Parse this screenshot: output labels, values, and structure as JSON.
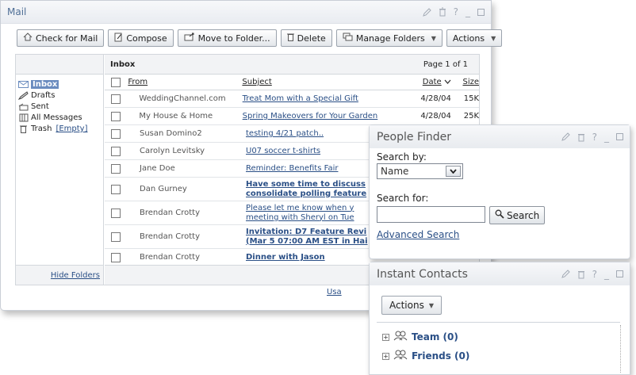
{
  "mail": {
    "title": "Mail",
    "toolbar": {
      "check": "Check for Mail",
      "compose": "Compose",
      "move": "Move to Folder...",
      "delete": "Delete",
      "manage": "Manage Folders",
      "actions": "Actions"
    },
    "folders": [
      {
        "label": "Inbox",
        "icon": "envelope-icon",
        "selected": true
      },
      {
        "label": "Drafts",
        "icon": "pencil-icon"
      },
      {
        "label": "Sent",
        "icon": "sent-icon"
      },
      {
        "label": "All Messages",
        "icon": "all-messages-icon"
      },
      {
        "label": "Trash",
        "icon": "trash-icon",
        "extra": "[Empty]"
      }
    ],
    "hide_folders": "Hide Folders",
    "inbox_title": "Inbox",
    "page_info": "Page 1 of 1",
    "columns": {
      "from": "From",
      "subject": "Subject",
      "date": "Date",
      "size": "Size"
    },
    "messages": [
      {
        "from": "WeddingChannel.com",
        "subject": "Treat Mom with a Special Gift",
        "date": "4/28/04",
        "size": "15K"
      },
      {
        "from": "My House & Home",
        "subject": "Spring Makeovers for Your Garden",
        "date": "4/28/04",
        "size": "25K"
      },
      {
        "from": "Susan Domino2",
        "subject": "testing 4/21 patch..",
        "date": "",
        "size": ""
      },
      {
        "from": "Carolyn Levitsky",
        "subject": "U07 soccer t-shirts",
        "date": "",
        "size": ""
      },
      {
        "from": "Jane Doe",
        "subject": "Reminder: Benefits Fair",
        "date": "",
        "size": ""
      },
      {
        "from": "Dan Gurney",
        "subject": "Have some time to discuss",
        "subject2": "consolidate polling feature",
        "bold": true
      },
      {
        "from": "Brendan Crotty",
        "subject": "Please let me know when y",
        "subject2": "meeting with Sheryl on Tue"
      },
      {
        "from": "Brendan Crotty",
        "subject": "Invitation: D7 Feature Revi",
        "subject2": "(Mar 5 07:00 AM EST in Hai",
        "bold": true
      },
      {
        "from": "Brendan Crotty",
        "subject": "Dinner with Jason",
        "bold": true
      }
    ],
    "usage": "Usa"
  },
  "people": {
    "title": "People Finder",
    "search_by": "Search by:",
    "search_by_value": "Name",
    "search_for": "Search for:",
    "search_btn": "Search",
    "advanced": "Advanced Search"
  },
  "contacts": {
    "title": "Instant Contacts",
    "actions": "Actions",
    "groups": [
      {
        "name": "Team (0)"
      },
      {
        "name": "Friends (0)"
      }
    ]
  }
}
